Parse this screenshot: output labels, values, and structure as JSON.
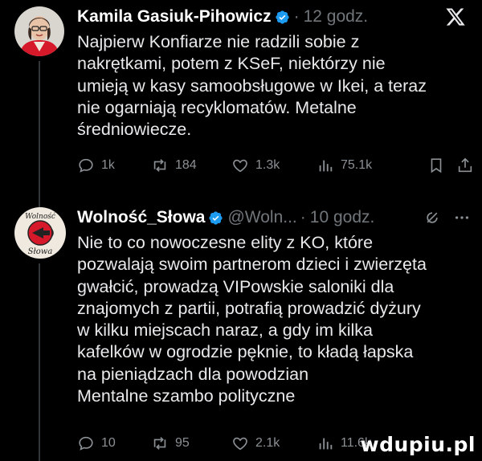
{
  "tweets": [
    {
      "author": "Kamila Gasiuk-Pihowicz",
      "separator": "·",
      "time": "12 godz.",
      "text": "Najpierw Konfiarze nie radzili sobie z\nnakrętkami, potem z KSeF, niektórzy nie\numieją w kasy samoobsługowe w Ikei, a teraz\nnie ogarniają recyklomatów. Metalne\nśredniowiecze.",
      "replies": "1k",
      "reposts": "184",
      "likes": "1.3k",
      "views": "75.1k"
    },
    {
      "author": "Wolność_Słowa",
      "handle": "@Woln...",
      "separator": "·",
      "time": "10 godz.",
      "text": "Nie to co nowoczesne elity z KO, które\npozwalają swoim partnerom dzieci i zwierzęta\ngwałcić, prowadzą VIPowskie saloniki dla\nznajomych z partii, potrafią prowadzić dyżury\nw kilku miejscach naraz, a gdy im kilka\nkafelków w ogrodzie pęknie, to kładą łapska\nna pieniądzach dla powodzian\nMentalne szambo polityczne",
      "replies": "10",
      "reposts": "95",
      "likes": "2.1k",
      "views": "11.6k",
      "avatar_text_top": "Wolność",
      "avatar_text_bottom": "Słowa"
    }
  ],
  "watermark": "wdupiu.pl",
  "colors": {
    "background": "#000000",
    "verified": "#1d9bf0",
    "muted": "#71767b"
  }
}
